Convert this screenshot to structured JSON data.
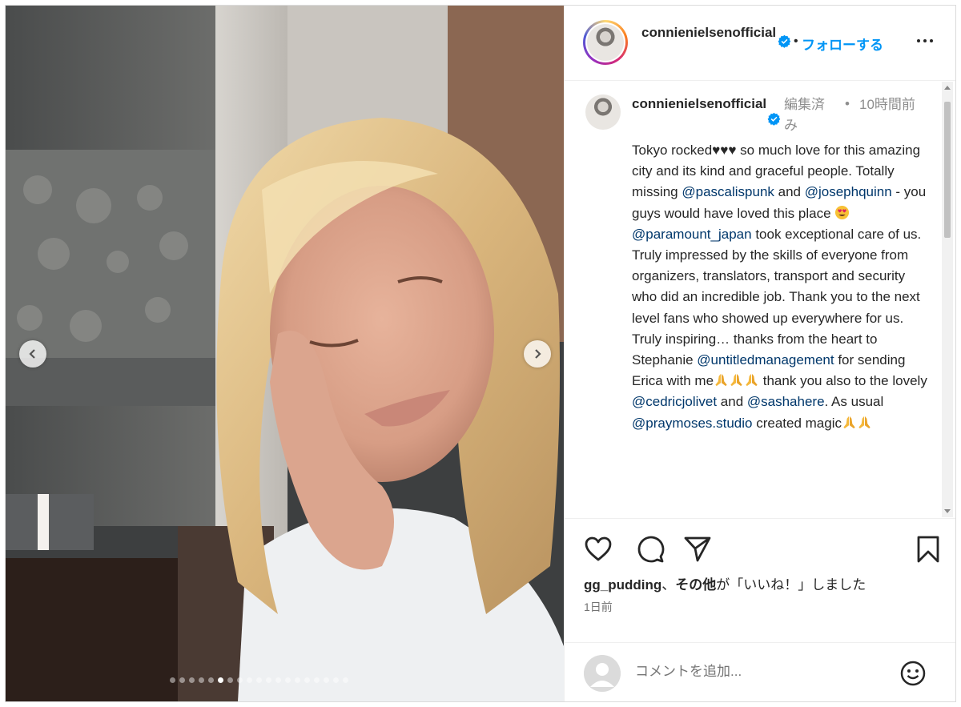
{
  "carousel": {
    "slide_count": 19,
    "active_index": 5
  },
  "header": {
    "username": "connienielsenofficial",
    "separator": "•",
    "follow_label": "フォローする"
  },
  "caption": {
    "username": "connienielsenofficial",
    "edited": "編集済み",
    "separator": "•",
    "time": "10時間前",
    "segments": [
      {
        "t": "text",
        "v": "Tokyo rocked"
      },
      {
        "t": "text",
        "v": "♥♥♥"
      },
      {
        "t": "text",
        "v": " so much love for this amazing city and its kind and graceful people. Totally missing "
      },
      {
        "t": "mention",
        "v": "@pascalispunk"
      },
      {
        "t": "text",
        "v": " and "
      },
      {
        "t": "mention",
        "v": "@josephquinn"
      },
      {
        "t": "text",
        "v": " - you guys would have loved this place "
      },
      {
        "t": "emoji",
        "v": "heart-eyes"
      },
      {
        "t": "text",
        "v": " "
      },
      {
        "t": "mention",
        "v": "@paramount_japan"
      },
      {
        "t": "text",
        "v": " took exceptional care of us. Truly impressed by the skills of everyone from organizers, translators, transport and security who did an incredible job. Thank you to the next level fans who showed up everywhere for us. Truly inspiring… thanks from the heart to Stephanie "
      },
      {
        "t": "mention",
        "v": "@untitledmanagement"
      },
      {
        "t": "text",
        "v": " for sending Erica with me"
      },
      {
        "t": "emoji",
        "v": "pray"
      },
      {
        "t": "emoji",
        "v": "pray"
      },
      {
        "t": "emoji",
        "v": "pray"
      },
      {
        "t": "text",
        "v": " thank you also to the lovely "
      },
      {
        "t": "mention",
        "v": "@cedricjolivet"
      },
      {
        "t": "text",
        "v": " and "
      },
      {
        "t": "mention",
        "v": "@sashahere"
      },
      {
        "t": "text",
        "v": ". As usual "
      },
      {
        "t": "mention",
        "v": "@praymoses.studio"
      },
      {
        "t": "text",
        "v": " created magic"
      },
      {
        "t": "emoji",
        "v": "pray"
      },
      {
        "t": "emoji",
        "v": "pray"
      }
    ]
  },
  "likes": {
    "user": "gg_pudding",
    "mid": "、",
    "others": "その他",
    "suffix": "が「いいね！」しました"
  },
  "date": "1日前",
  "comment": {
    "placeholder": "コメントを追加..."
  },
  "colors": {
    "accent": "#0095f6",
    "mention": "#00376b",
    "secondary_text": "#8e8e8e"
  }
}
